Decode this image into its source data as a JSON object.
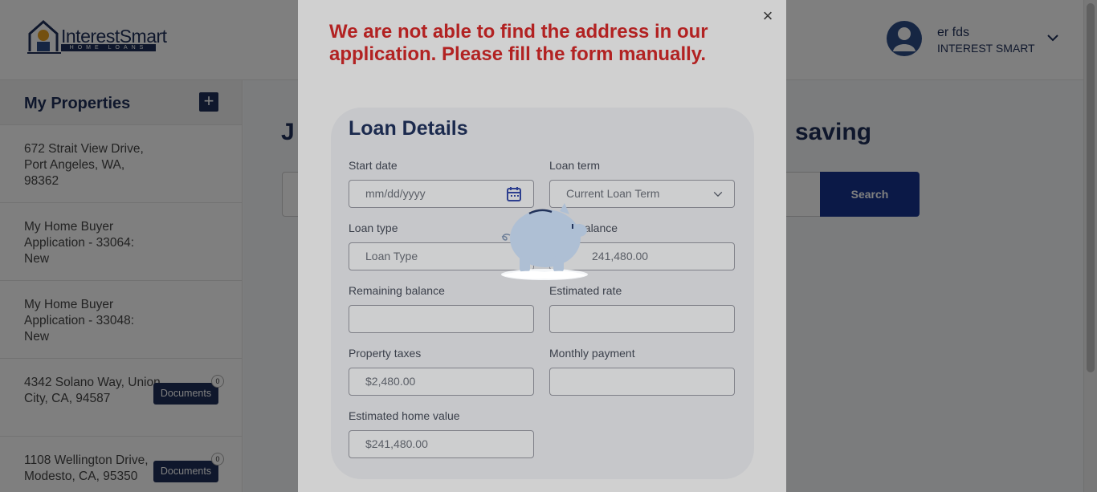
{
  "header": {
    "logo_brand": "InterestSmart",
    "logo_sub": "HOME LOANS",
    "user_name": "er fds",
    "user_org": "INTEREST SMART",
    "chevron_icon": "chevron-down-icon"
  },
  "sidebar": {
    "title": "My Properties",
    "add_label": "+",
    "items": [
      {
        "label": "672 Strait View Drive, Port Angeles, WA, 98362"
      },
      {
        "label": "My Home Buyer Application - 33064: New"
      },
      {
        "label": "My Home Buyer Application - 33048: New"
      },
      {
        "label": "4342 Solano Way, Union City, CA, 94587",
        "doc_label": "Documents",
        "doc_count": "0"
      },
      {
        "label": "1108 Wellington Drive, Modesto, CA, 95350",
        "doc_label": "Documents",
        "doc_count": "0"
      }
    ]
  },
  "main": {
    "heading_left": "J",
    "heading_right": "saving",
    "search_button": "Search"
  },
  "modal": {
    "close_label": "×",
    "alert_text": "We are not able to find the address in our application. Please fill the form manually.",
    "card_title": "Loan Details",
    "fields": {
      "start_date": {
        "label": "Start date",
        "placeholder": "mm/dd/yyyy",
        "icon": "calendar-icon"
      },
      "loan_term": {
        "label": "Loan term",
        "value": "Current Loan Term",
        "icon": "chevron-down-icon"
      },
      "loan_type": {
        "label": "Loan type",
        "value": "Loan Type"
      },
      "balance": {
        "label": "balance",
        "value": "241,480.00"
      },
      "remaining_balance": {
        "label": "Remaining balance",
        "value": ""
      },
      "estimated_rate": {
        "label": "Estimated rate",
        "value": ""
      },
      "property_taxes": {
        "label": "Property taxes",
        "value": "$2,480.00"
      },
      "monthly_payment": {
        "label": "Monthly payment",
        "value": ""
      },
      "estimated_home_value": {
        "label": "Estimated home value",
        "value": "$241,480.00"
      }
    },
    "loader_icon": "piggy-bank-icon"
  },
  "colors": {
    "brand": "#1e2f58",
    "alert": "#b22222",
    "search_button": "#17328f"
  }
}
